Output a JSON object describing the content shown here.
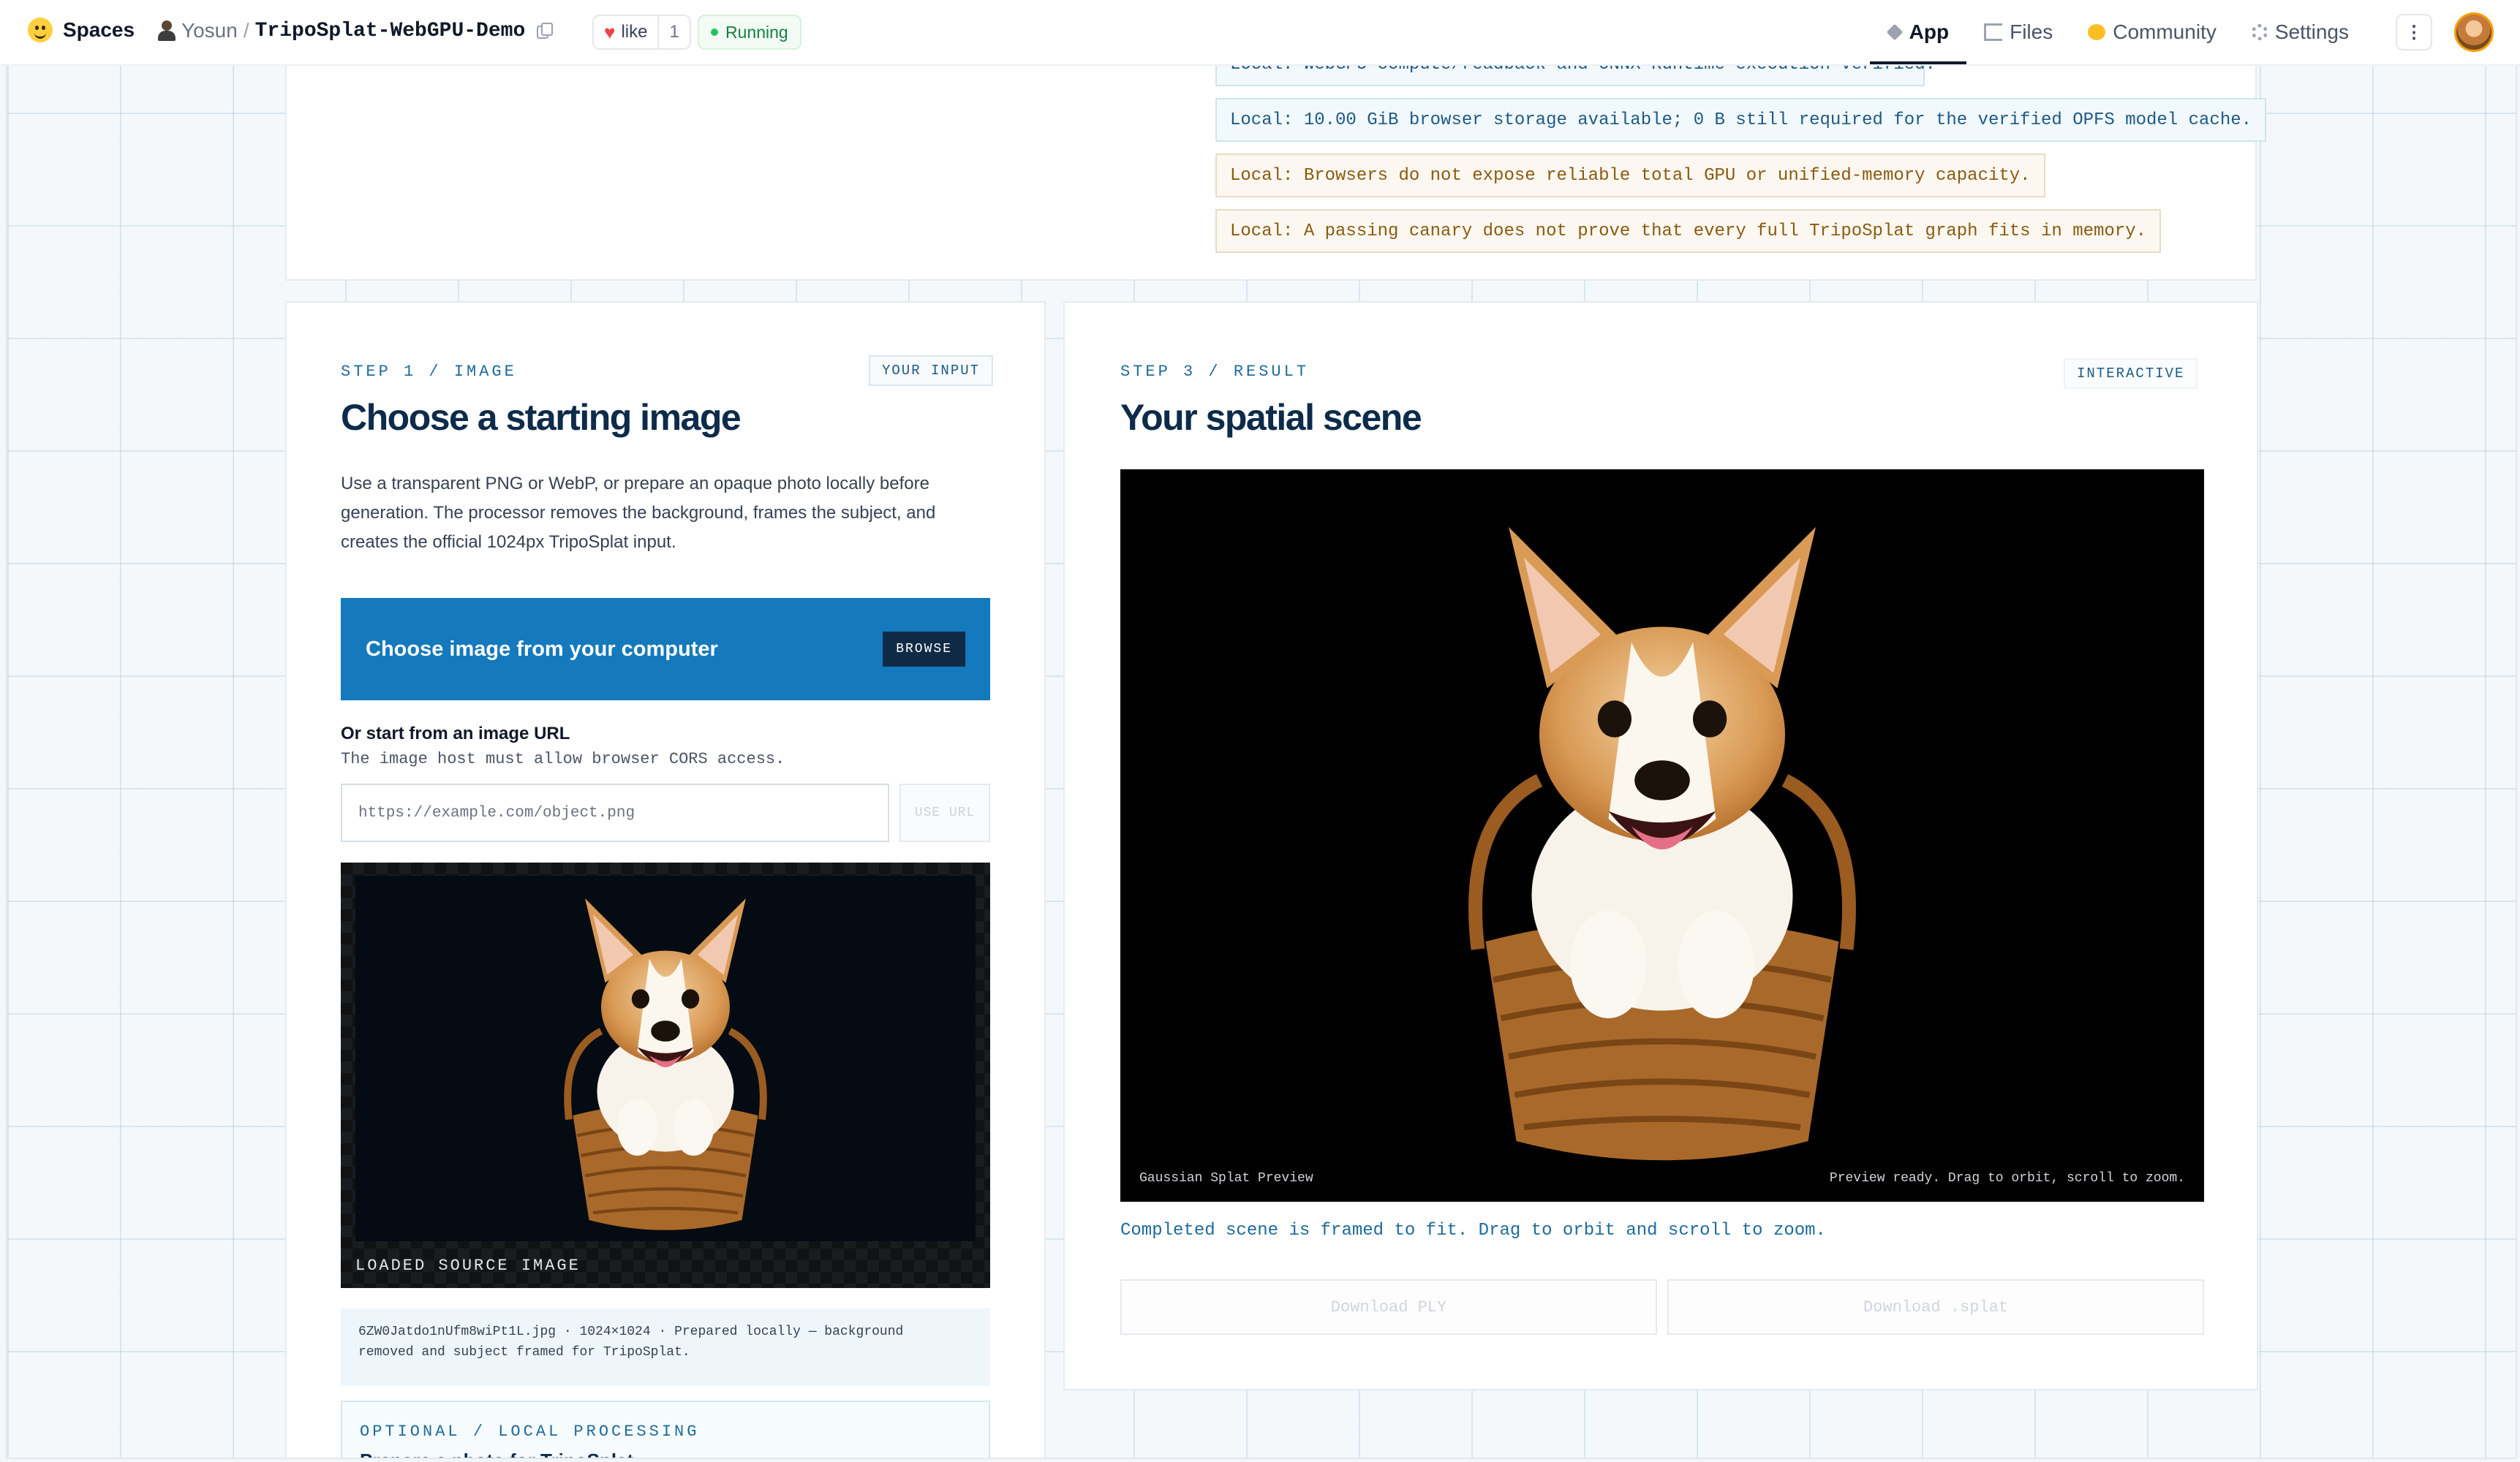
{
  "topbar": {
    "brand": "Spaces",
    "owner": "Yosun",
    "separator": "/",
    "repo": "TripoSplat-WebGPU-Demo",
    "like_label": "like",
    "like_count": "1",
    "status": "Running",
    "tabs": [
      {
        "label": "App",
        "icon": "cube-icon",
        "active": true
      },
      {
        "label": "Files",
        "icon": "files-icon",
        "active": false
      },
      {
        "label": "Community",
        "icon": "community-icon",
        "active": false
      },
      {
        "label": "Settings",
        "icon": "gear-icon",
        "active": false
      }
    ],
    "more_label": "⋮"
  },
  "verification": {
    "notes": [
      {
        "text": "Local: WebGPU compute/readback and ONNX Runtime execution verified.",
        "tone": "blue"
      },
      {
        "text": "Local: 10.00 GiB browser storage available; 0 B still required for the verified OPFS model cache.",
        "tone": "blue"
      },
      {
        "text": "Local: Browsers do not expose reliable total GPU or unified-memory capacity.",
        "tone": "amber"
      },
      {
        "text": "Local: A passing canary does not prove that every full TripoSplat graph fits in memory.",
        "tone": "amber"
      }
    ]
  },
  "input_card": {
    "step": "STEP 1 / IMAGE",
    "tag": "YOUR INPUT",
    "title": "Choose a starting image",
    "description": [
      "Use a transparent PNG or WebP, or prepare an opaque photo locally before",
      "generation. The processor removes the background, frames the subject, and",
      "creates the official 1024px TripoSplat input."
    ],
    "browse_title": "Choose image from your computer",
    "browse_button": "BROWSE",
    "url_label": "Or start from an image URL",
    "url_help": "The image host must allow browser CORS access.",
    "url_placeholder": "https://example.com/object.png",
    "url_value": "",
    "url_button": "USE URL",
    "preview_label": "LOADED SOURCE IMAGE",
    "file_meta": [
      "6ZW0Jatdo1nUfm8wiPt1L.jpg · 1024×1024 · Prepared locally — background",
      "removed and subject framed for TripoSplat."
    ],
    "optional_step": "OPTIONAL / LOCAL PROCESSING",
    "optional_sub": "Prepare a photo for TripoSplat"
  },
  "result_card": {
    "step": "STEP 3 / RESULT",
    "tag": "INTERACTIVE",
    "title": "Your spatial scene",
    "viewer_caption_left": "Gaussian Splat Preview",
    "viewer_caption_right": "Preview ready. Drag to orbit, scroll to zoom.",
    "message": "Completed scene is framed to fit. Drag to orbit and scroll to zoom.",
    "download_ply": "Download PLY",
    "download_splat": "Download .splat"
  }
}
